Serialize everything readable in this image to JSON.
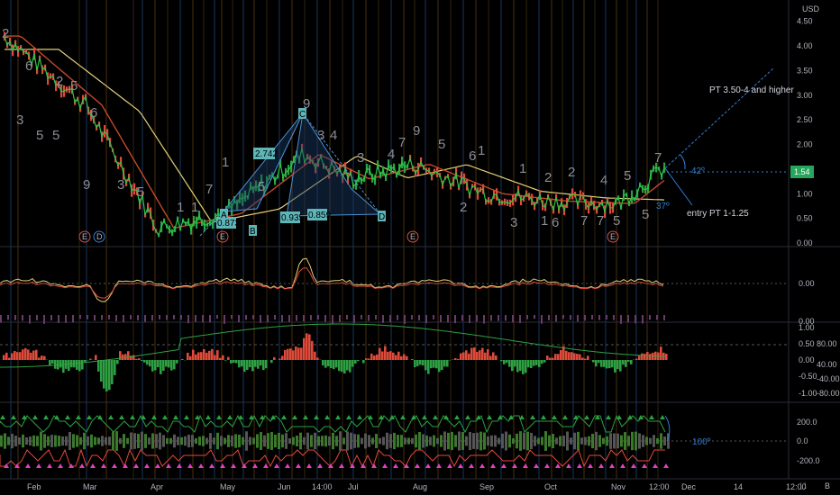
{
  "header": {
    "currency": "USD"
  },
  "price_axis": {
    "ticks": [
      "4.50",
      "4.00",
      "3.50",
      "3.00",
      "2.50",
      "2.00",
      "1.50",
      "1.00",
      "0.50",
      "0.00"
    ],
    "last_price": "1.54"
  },
  "time_axis": {
    "labels": [
      "Feb",
      "Mar",
      "Apr",
      "May",
      "Jun",
      "14:00",
      "Jul",
      "Aug",
      "Sep",
      "Oct",
      "Nov",
      "12:00",
      "Dec",
      "14",
      "12:00"
    ]
  },
  "annotations": {
    "target_label": "PT 3.50-4 and higher",
    "entry_label": "entry PT 1-1.25",
    "angle_up": "42º",
    "angle_down": "37º",
    "angle_osc": "100º"
  },
  "harmonic_labels": [
    "2.742",
    "0.873",
    "0.935",
    "0.859"
  ],
  "pattern_points": [
    "C",
    "A",
    "B",
    "D"
  ],
  "event_markers": [
    "E",
    "D",
    "E",
    "E",
    "E"
  ],
  "indicator_axes": {
    "osc1": [
      "0.00"
    ],
    "osc2_left": [
      "1.00",
      "0.50",
      "0.00",
      "-0.50",
      "-1.00"
    ],
    "osc2_right": [
      "80.00",
      "40.00",
      "-40.00",
      "-80.00"
    ],
    "osc3": [
      "200.0",
      "0.0",
      "-200.0"
    ],
    "osc1_top": "0.00"
  },
  "toolbar": {
    "expand_icon": "expand-icon",
    "settings_icon": "gear-icon",
    "b_icon": "B"
  },
  "chart_data": {
    "type": "line",
    "x": [
      "Feb",
      "Mar",
      "Apr",
      "May",
      "Jun",
      "Jul",
      "Aug",
      "Sep",
      "Oct",
      "Nov",
      "Dec"
    ],
    "series": [
      {
        "values": [
          4.2,
          2.8,
          0.3,
          0.6,
          1.8,
          1.3,
          1.6,
          1.0,
          0.85,
          0.8,
          1.54
        ]
      }
    ],
    "ylim": [
      0,
      4.75
    ],
    "grid": true
  }
}
